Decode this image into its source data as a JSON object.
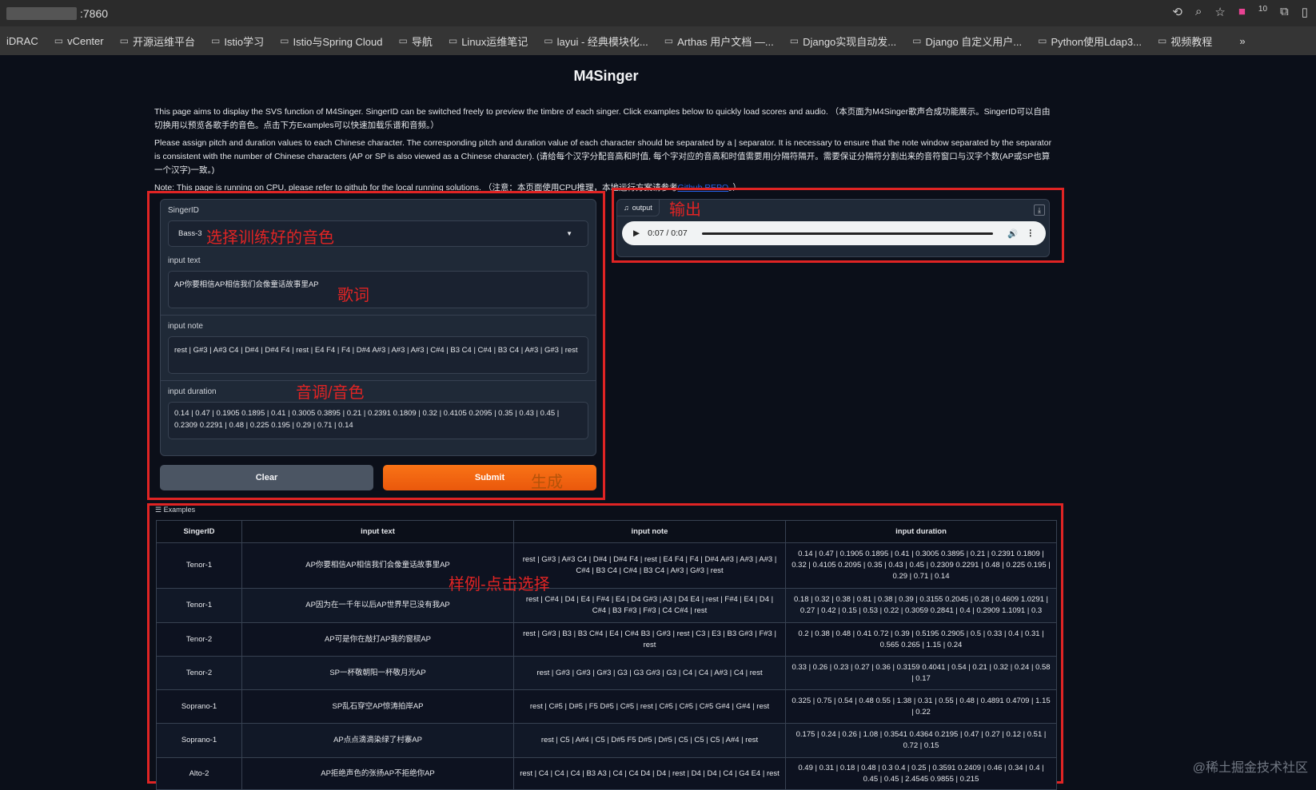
{
  "browser": {
    "address": ":7860",
    "badge_count": "10",
    "bookmarks": [
      "iDRAC",
      "vCenter",
      "开源运维平台",
      "Istio学习",
      "Istio与Spring Cloud",
      "导航",
      "Linux运维笔记",
      "layui - 经典模块化...",
      "Arthas 用户文档 —...",
      "Django实现自动发...",
      "Django 自定义用户...",
      "Python使用Ldap3...",
      "视频教程"
    ],
    "more": "»"
  },
  "page": {
    "title": "M4Singer",
    "intro1": "This page aims to display the SVS function of M4Singer. SingerID can be switched freely to preview the timbre of each singer. Click examples below to quickly load scores and audio. （本页面为M4Singer歌声合成功能展示。SingerID可以自由切换用以预览各歌手的音色。点击下方Examples可以快速加载乐谱和音频。）",
    "intro2": "Please assign pitch and duration values to each Chinese character. The corresponding pitch and duration value of each character should be separated by a | separator. It is necessary to ensure that the note window separated by the separator is consistent with the number of Chinese characters (AP or SP is also viewed as a Chinese character). (请给每个汉字分配音高和时值, 每个字对应的音高和时值需要用|分隔符隔开。需要保证分隔符分割出来的音符窗口与汉字个数(AP或SP也算一个汉字)一致。)",
    "note_prefix": "Note: This page is running on CPU, please refer to github for the local running solutions. （注意：本页面使用CPU推理，本地运行方案请参考",
    "note_link": "Github REPO",
    "note_suffix": "。）"
  },
  "form": {
    "singer_label": "SingerID",
    "singer_value": "Bass-3",
    "text_label": "input text",
    "text_value": "AP你要相信AP相信我们会像童话故事里AP",
    "note_label": "input note",
    "note_value": "rest | G#3 | A#3 C4 | D#4 | D#4 F4 | rest | E4 F4 | F4 | D#4 A#3 | A#3 | A#3 | C#4 | B3 C4 | C#4 | B3 C4 | A#3 | G#3 | rest",
    "duration_label": "input duration",
    "duration_value": "0.14 | 0.47 | 0.1905 0.1895 | 0.41 | 0.3005 0.3895 | 0.21 | 0.2391 0.1809 | 0.32 | 0.4105 0.2095 | 0.35 | 0.43 | 0.45 | 0.2309 0.2291 | 0.48 | 0.225 0.195 | 0.29 | 0.71 | 0.14",
    "clear_label": "Clear",
    "submit_label": "Submit"
  },
  "output": {
    "label": "output",
    "time": "0:07 / 0:07"
  },
  "annotations": {
    "singer": "选择训练好的音色",
    "lyrics": "歌词",
    "pitch": "音调/音色",
    "generate": "生成",
    "output": "输出",
    "examples": "样例-点击选择"
  },
  "examples": {
    "label": "Examples",
    "headers": [
      "SingerID",
      "input text",
      "input note",
      "input duration"
    ],
    "rows": [
      [
        "Tenor-1",
        "AP你要相信AP相信我们会像童话故事里AP",
        "rest | G#3 | A#3 C4 | D#4 | D#4 F4 | rest | E4 F4 | F4 | D#4 A#3 | A#3 | A#3 | C#4 | B3 C4 | C#4 | B3 C4 | A#3 | G#3 | rest",
        "0.14 | 0.47 | 0.1905 0.1895 | 0.41 | 0.3005 0.3895 | 0.21 | 0.2391 0.1809 | 0.32 | 0.4105 0.2095 | 0.35 | 0.43 | 0.45 | 0.2309 0.2291 | 0.48 | 0.225 0.195 | 0.29 | 0.71 | 0.14"
      ],
      [
        "Tenor-1",
        "AP因为在一千年以后AP世界早已没有我AP",
        "rest | C#4 | D4 | E4 | F#4 | E4 | D4 G#3 | A3 | D4 E4 | rest | F#4 | E4 | D4 | C#4 | B3 F#3 | F#3 | C4 C#4 | rest",
        "0.18 | 0.32 | 0.38 | 0.81 | 0.38 | 0.39 | 0.3155 0.2045 | 0.28 | 0.4609 1.0291 | 0.27 | 0.42 | 0.15 | 0.53 | 0.22 | 0.3059 0.2841 | 0.4 | 0.2909 1.1091 | 0.3"
      ],
      [
        "Tenor-2",
        "AP可是你在敲打AP我的窗棂AP",
        "rest | G#3 | B3 | B3 C#4 | E4 | C#4 B3 | G#3 | rest | C3 | E3 | B3 G#3 | F#3 | rest",
        "0.2 | 0.38 | 0.48 | 0.41 0.72 | 0.39 | 0.5195 0.2905 | 0.5 | 0.33 | 0.4 | 0.31 | 0.565 0.265 | 1.15 | 0.24"
      ],
      [
        "Tenor-2",
        "SP一杯敬朝阳一杯敬月光AP",
        "rest | G#3 | G#3 | G#3 | G3 | G3 G#3 | G3 | C4 | C4 | A#3 | C4 | rest",
        "0.33 | 0.26 | 0.23 | 0.27 | 0.36 | 0.3159 0.4041 | 0.54 | 0.21 | 0.32 | 0.24 | 0.58 | 0.17"
      ],
      [
        "Soprano-1",
        "SP乱石穿空AP惊涛拍岸AP",
        "rest | C#5 | D#5 | F5 D#5 | C#5 | rest | C#5 | C#5 | C#5 G#4 | G#4 | rest",
        "0.325 | 0.75 | 0.54 | 0.48 0.55 | 1.38 | 0.31 | 0.55 | 0.48 | 0.4891 0.4709 | 1.15 | 0.22"
      ],
      [
        "Soprano-1",
        "AP点点滴滴染绿了村寨AP",
        "rest | C5 | A#4 | C5 | D#5 F5 D#5 | D#5 | C5 | C5 | C5 | A#4 | rest",
        "0.175 | 0.24 | 0.26 | 1.08 | 0.3541 0.4364 0.2195 | 0.47 | 0.27 | 0.12 | 0.51 | 0.72 | 0.15"
      ],
      [
        "Alto-2",
        "AP拒绝声色的张扬AP不拒绝你AP",
        "rest | C4 | C4 | C4 | B3 A3 | C4 | C4 D4 | D4 | rest | D4 | D4 | C4 | G4 E4 | rest",
        "0.49 | 0.31 | 0.18 | 0.48 | 0.3 0.4 | 0.25 | 0.3591 0.2409 | 0.46 | 0.34 | 0.4 | 0.45 | 0.45 | 2.4545 0.9855 | 0.215"
      ]
    ]
  },
  "watermark": "@稀土掘金技术社区"
}
